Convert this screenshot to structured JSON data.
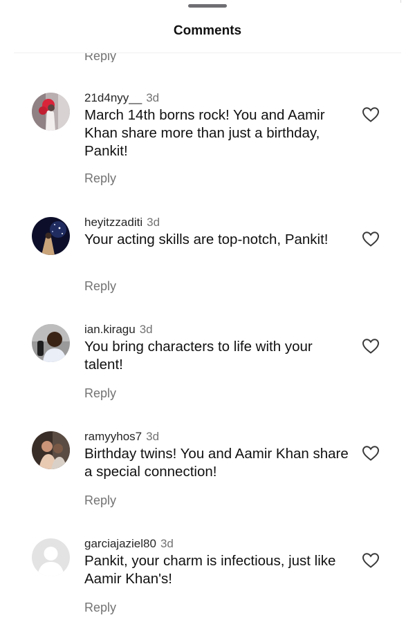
{
  "header": {
    "title": "Comments"
  },
  "top_reply": "Reply",
  "comments": [
    {
      "username": "21d4nyy__",
      "time": "3d",
      "text": "March 14th borns rock! You and Aamir Khan share more than just a birthday, Pankit!",
      "reply": "Reply"
    },
    {
      "username": "heyitzzaditi",
      "time": "3d",
      "text": "Your acting skills are top-notch, Pankit!",
      "reply": "Reply"
    },
    {
      "username": "ian.kiragu",
      "time": "3d",
      "text": "You bring characters to life with your talent!",
      "reply": "Reply"
    },
    {
      "username": "ramyyhos7",
      "time": "3d",
      "text": "Birthday twins! You and Aamir Khan share a special connection!",
      "reply": "Reply"
    },
    {
      "username": "garciajaziel80",
      "time": "3d",
      "text": "Pankit, your charm is infectious, just like Aamir Khan's!",
      "reply": "Reply"
    }
  ],
  "icons": {
    "like": "heart-icon",
    "drag": "drag-handle"
  }
}
